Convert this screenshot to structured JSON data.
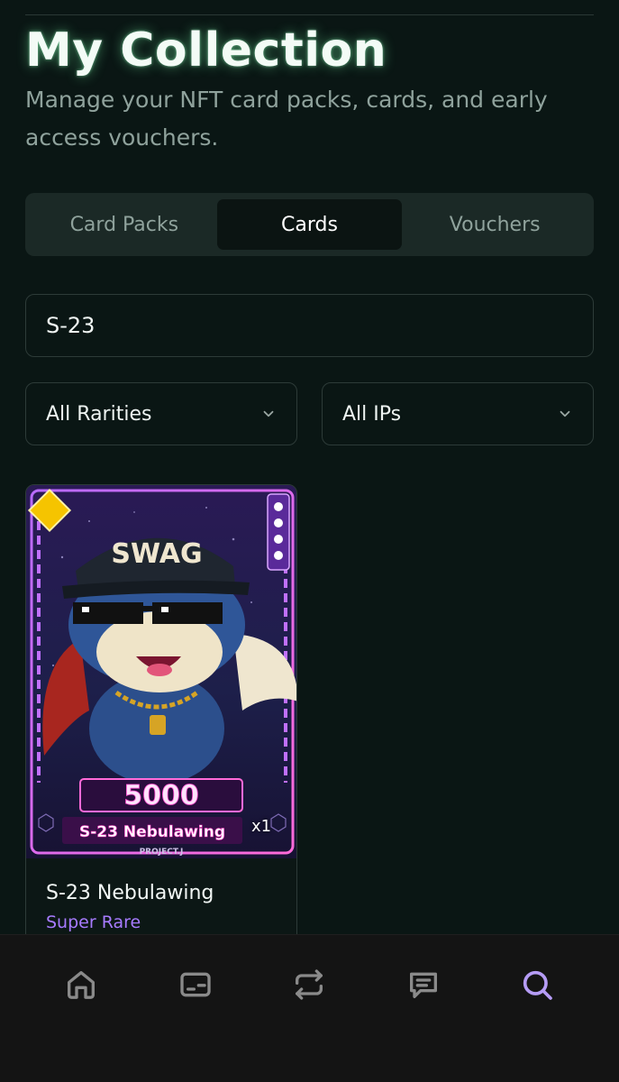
{
  "header": {
    "title": "My Collection",
    "subtitle": "Manage your NFT card packs, cards, and early access vouchers."
  },
  "tabs": [
    {
      "label": "Card Packs",
      "active": false
    },
    {
      "label": "Cards",
      "active": true
    },
    {
      "label": "Vouchers",
      "active": false
    }
  ],
  "search": {
    "value": "S-23",
    "placeholder": ""
  },
  "filters": {
    "rarity": {
      "selected": "All Rarities"
    },
    "ip": {
      "selected": "All IPs"
    }
  },
  "cards": [
    {
      "name": "S-23 Nebulawing",
      "rarity": "Super Rare",
      "quantity": "x1",
      "art": {
        "cap_text": "SWAG",
        "power": "5000",
        "banner_name": "S-23 Nebulawing",
        "brand": "PROJECT.J",
        "element_badge": "YELLOW"
      }
    }
  ],
  "nav": [
    {
      "name": "home-icon",
      "active": false
    },
    {
      "name": "wallet-icon",
      "active": false
    },
    {
      "name": "swap-icon",
      "active": false
    },
    {
      "name": "chat-icon",
      "active": false
    },
    {
      "name": "search-icon",
      "active": true
    }
  ],
  "colors": {
    "background": "#0a1614",
    "accent_active_nav": "#b59cf5",
    "rarity_super_rare": "#a77bff",
    "nav_inactive": "#8a8a8a"
  }
}
